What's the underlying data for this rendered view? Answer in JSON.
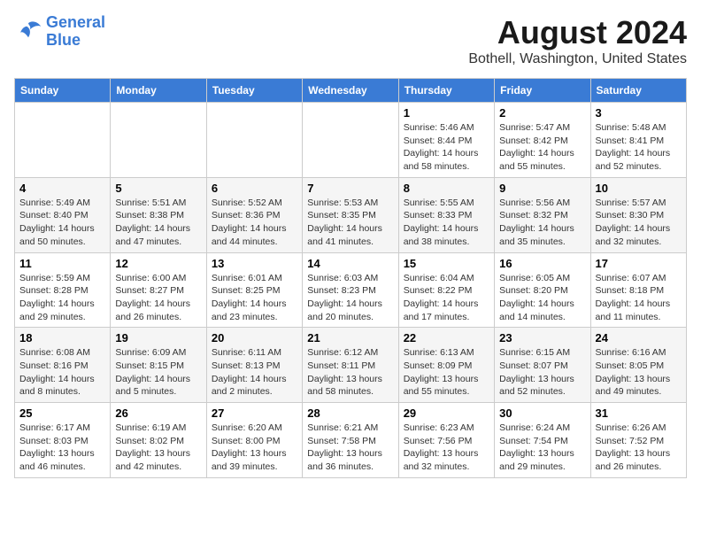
{
  "header": {
    "logo_line1": "General",
    "logo_line2": "Blue",
    "title": "August 2024",
    "subtitle": "Bothell, Washington, United States"
  },
  "weekdays": [
    "Sunday",
    "Monday",
    "Tuesday",
    "Wednesday",
    "Thursday",
    "Friday",
    "Saturday"
  ],
  "weeks": [
    [
      {
        "day": "",
        "info": ""
      },
      {
        "day": "",
        "info": ""
      },
      {
        "day": "",
        "info": ""
      },
      {
        "day": "",
        "info": ""
      },
      {
        "day": "1",
        "info": "Sunrise: 5:46 AM\nSunset: 8:44 PM\nDaylight: 14 hours\nand 58 minutes."
      },
      {
        "day": "2",
        "info": "Sunrise: 5:47 AM\nSunset: 8:42 PM\nDaylight: 14 hours\nand 55 minutes."
      },
      {
        "day": "3",
        "info": "Sunrise: 5:48 AM\nSunset: 8:41 PM\nDaylight: 14 hours\nand 52 minutes."
      }
    ],
    [
      {
        "day": "4",
        "info": "Sunrise: 5:49 AM\nSunset: 8:40 PM\nDaylight: 14 hours\nand 50 minutes."
      },
      {
        "day": "5",
        "info": "Sunrise: 5:51 AM\nSunset: 8:38 PM\nDaylight: 14 hours\nand 47 minutes."
      },
      {
        "day": "6",
        "info": "Sunrise: 5:52 AM\nSunset: 8:36 PM\nDaylight: 14 hours\nand 44 minutes."
      },
      {
        "day": "7",
        "info": "Sunrise: 5:53 AM\nSunset: 8:35 PM\nDaylight: 14 hours\nand 41 minutes."
      },
      {
        "day": "8",
        "info": "Sunrise: 5:55 AM\nSunset: 8:33 PM\nDaylight: 14 hours\nand 38 minutes."
      },
      {
        "day": "9",
        "info": "Sunrise: 5:56 AM\nSunset: 8:32 PM\nDaylight: 14 hours\nand 35 minutes."
      },
      {
        "day": "10",
        "info": "Sunrise: 5:57 AM\nSunset: 8:30 PM\nDaylight: 14 hours\nand 32 minutes."
      }
    ],
    [
      {
        "day": "11",
        "info": "Sunrise: 5:59 AM\nSunset: 8:28 PM\nDaylight: 14 hours\nand 29 minutes."
      },
      {
        "day": "12",
        "info": "Sunrise: 6:00 AM\nSunset: 8:27 PM\nDaylight: 14 hours\nand 26 minutes."
      },
      {
        "day": "13",
        "info": "Sunrise: 6:01 AM\nSunset: 8:25 PM\nDaylight: 14 hours\nand 23 minutes."
      },
      {
        "day": "14",
        "info": "Sunrise: 6:03 AM\nSunset: 8:23 PM\nDaylight: 14 hours\nand 20 minutes."
      },
      {
        "day": "15",
        "info": "Sunrise: 6:04 AM\nSunset: 8:22 PM\nDaylight: 14 hours\nand 17 minutes."
      },
      {
        "day": "16",
        "info": "Sunrise: 6:05 AM\nSunset: 8:20 PM\nDaylight: 14 hours\nand 14 minutes."
      },
      {
        "day": "17",
        "info": "Sunrise: 6:07 AM\nSunset: 8:18 PM\nDaylight: 14 hours\nand 11 minutes."
      }
    ],
    [
      {
        "day": "18",
        "info": "Sunrise: 6:08 AM\nSunset: 8:16 PM\nDaylight: 14 hours\nand 8 minutes."
      },
      {
        "day": "19",
        "info": "Sunrise: 6:09 AM\nSunset: 8:15 PM\nDaylight: 14 hours\nand 5 minutes."
      },
      {
        "day": "20",
        "info": "Sunrise: 6:11 AM\nSunset: 8:13 PM\nDaylight: 14 hours\nand 2 minutes."
      },
      {
        "day": "21",
        "info": "Sunrise: 6:12 AM\nSunset: 8:11 PM\nDaylight: 13 hours\nand 58 minutes."
      },
      {
        "day": "22",
        "info": "Sunrise: 6:13 AM\nSunset: 8:09 PM\nDaylight: 13 hours\nand 55 minutes."
      },
      {
        "day": "23",
        "info": "Sunrise: 6:15 AM\nSunset: 8:07 PM\nDaylight: 13 hours\nand 52 minutes."
      },
      {
        "day": "24",
        "info": "Sunrise: 6:16 AM\nSunset: 8:05 PM\nDaylight: 13 hours\nand 49 minutes."
      }
    ],
    [
      {
        "day": "25",
        "info": "Sunrise: 6:17 AM\nSunset: 8:03 PM\nDaylight: 13 hours\nand 46 minutes."
      },
      {
        "day": "26",
        "info": "Sunrise: 6:19 AM\nSunset: 8:02 PM\nDaylight: 13 hours\nand 42 minutes."
      },
      {
        "day": "27",
        "info": "Sunrise: 6:20 AM\nSunset: 8:00 PM\nDaylight: 13 hours\nand 39 minutes."
      },
      {
        "day": "28",
        "info": "Sunrise: 6:21 AM\nSunset: 7:58 PM\nDaylight: 13 hours\nand 36 minutes."
      },
      {
        "day": "29",
        "info": "Sunrise: 6:23 AM\nSunset: 7:56 PM\nDaylight: 13 hours\nand 32 minutes."
      },
      {
        "day": "30",
        "info": "Sunrise: 6:24 AM\nSunset: 7:54 PM\nDaylight: 13 hours\nand 29 minutes."
      },
      {
        "day": "31",
        "info": "Sunrise: 6:26 AM\nSunset: 7:52 PM\nDaylight: 13 hours\nand 26 minutes."
      }
    ]
  ]
}
